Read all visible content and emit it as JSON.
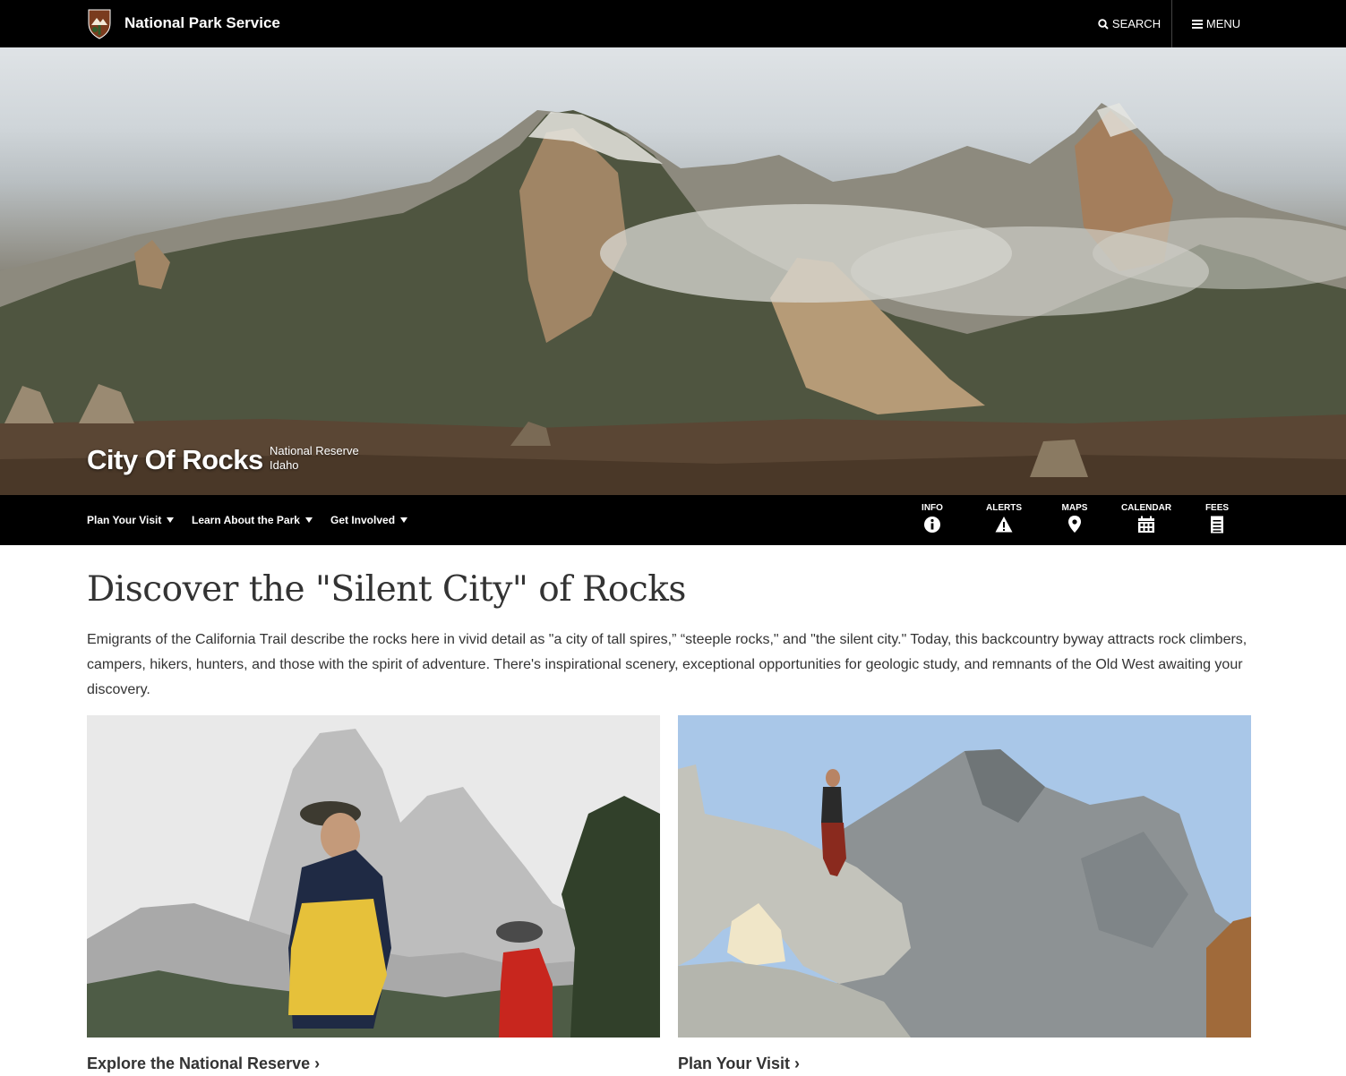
{
  "header": {
    "brand": "National Park Service",
    "search_label": "SEARCH",
    "menu_label": "MENU"
  },
  "hero": {
    "park_name": "City Of Rocks",
    "designation": "National Reserve",
    "state": "Idaho"
  },
  "subnav": {
    "items": [
      {
        "label": "Plan Your Visit"
      },
      {
        "label": "Learn About the Park"
      },
      {
        "label": "Get Involved"
      }
    ],
    "quick_links": [
      {
        "label": "INFO",
        "icon": "info-icon"
      },
      {
        "label": "ALERTS",
        "icon": "alert-icon"
      },
      {
        "label": "MAPS",
        "icon": "map-pin-icon"
      },
      {
        "label": "CALENDAR",
        "icon": "calendar-icon"
      },
      {
        "label": "FEES",
        "icon": "fees-icon"
      }
    ]
  },
  "main": {
    "heading": "Discover the \"Silent City\" of Rocks",
    "intro": "Emigrants of the California Trail describe the rocks here in vivid detail as \"a city of tall spires,” “steeple rocks,\" and \"the silent city.\" Today, this backcountry byway attracts rock climbers, campers, hikers, hunters, and those with the spirit of adventure. There's inspirational scenery, exceptional opportunities for geologic study, and remnants of the Old West awaiting your discovery.",
    "cards": [
      {
        "link": "Explore the National Reserve ›"
      },
      {
        "link": "Plan Your Visit ›"
      }
    ]
  },
  "colors": {
    "bar_background": "#000000",
    "bar_text": "#ffffff",
    "body_text": "#333333"
  }
}
